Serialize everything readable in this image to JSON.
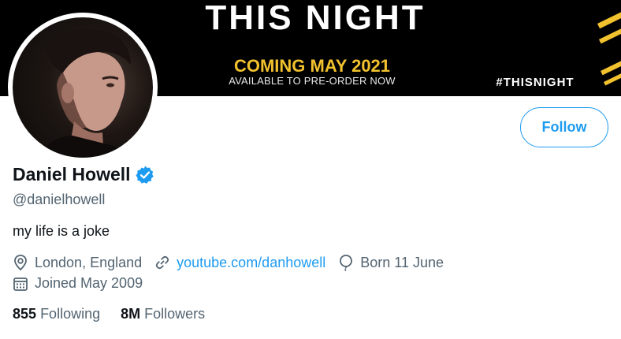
{
  "banner": {
    "title": "THIS NIGHT",
    "subtitle": "COMING MAY 2021",
    "preorder": "AVAILABLE TO PRE-ORDER NOW",
    "hashtag": "#THISNIGHT"
  },
  "profile": {
    "name": "Daniel Howell",
    "handle": "@danielhowell",
    "bio": "my life is a joke",
    "verified": true
  },
  "follow_button": {
    "label": "Follow"
  },
  "meta": {
    "location": "London, England",
    "website": "youtube.com/danhowell",
    "birthday": "Born 11 June",
    "joined": "Joined May 2009"
  },
  "stats": {
    "following_count": "855",
    "following_label": "Following",
    "followers_count": "8M",
    "followers_label": "Followers"
  },
  "colors": {
    "accent": "#1d9bf0",
    "banner_yellow": "#f2c12e",
    "text_primary": "#0f1419",
    "text_secondary": "#536471"
  }
}
